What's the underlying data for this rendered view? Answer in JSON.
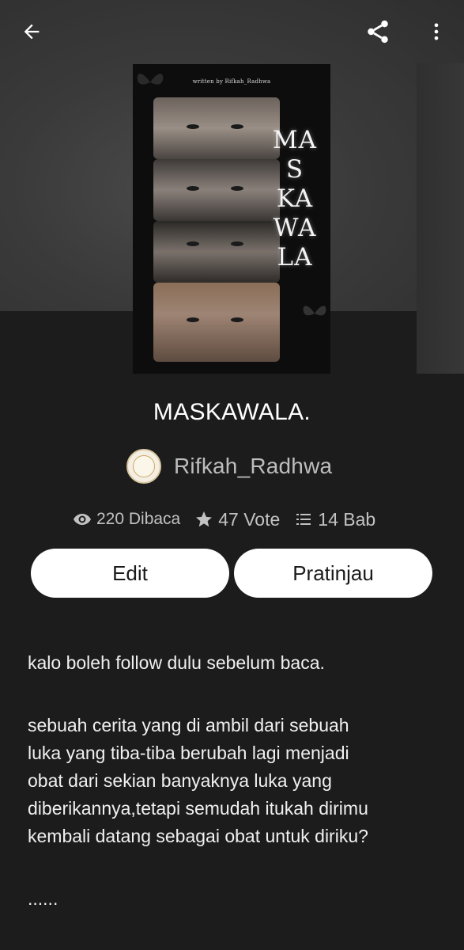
{
  "toolbar": {
    "back_icon": "arrow-left-icon",
    "share_icon": "share-icon",
    "more_icon": "more-vert-icon"
  },
  "cover": {
    "byline": "written by Rifkah_Radhwa",
    "title_lines": [
      "MA",
      "S",
      "KA",
      "WA",
      "LA"
    ]
  },
  "book": {
    "title": "MASKAWALA.",
    "author": "Rifkah_Radhwa"
  },
  "stats": {
    "reads": "220 Dibaca",
    "votes": "47 Vote",
    "parts": "14 Bab"
  },
  "actions": {
    "edit_label": "Edit",
    "preview_label": "Pratinjau"
  },
  "description": {
    "line1": "kalo boleh follow dulu sebelum baca.",
    "paragraph": [
      "sebuah cerita yang di ambil dari sebuah",
      "luka yang tiba-tiba berubah lagi menjadi",
      "obat dari sekian banyaknya luka yang",
      "diberikannya,tetapi semudah itukah dirimu",
      "kembali datang sebagai obat untuk diriku?"
    ],
    "ellipsis": "......"
  },
  "colors": {
    "background": "#1c1c1c",
    "button_bg": "#ffffff",
    "muted_text": "#bdbdbd"
  }
}
